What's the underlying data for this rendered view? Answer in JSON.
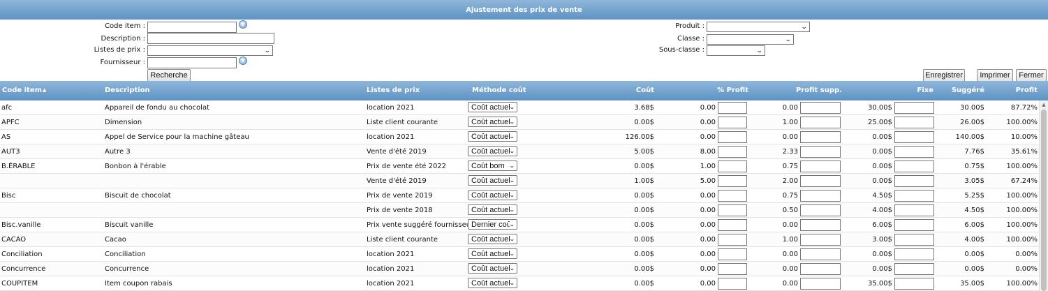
{
  "window": {
    "title": "Ajustement des prix de vente"
  },
  "filters": {
    "code_item_label": "Code item :",
    "description_label": "Description :",
    "listes_prix_label": "Listes de prix :",
    "fournisseur_label": "Fournisseur :",
    "produit_label": "Produit :",
    "classe_label": "Classe :",
    "sous_classe_label": "Sous-classe :",
    "code_item_value": "",
    "description_value": "",
    "fournisseur_value": "",
    "listes_prix_value": "",
    "produit_value": "",
    "classe_value": "",
    "sous_classe_value": ""
  },
  "buttons": {
    "recherche": "Recherche",
    "enregistrer": "Enregistrer",
    "imprimer": "Imprimer",
    "fermer": "Fermer"
  },
  "table": {
    "headers": {
      "code": "Code item",
      "description": "Description",
      "liste": "Listes de prix",
      "methode": "Méthode coût",
      "cout": "Coût",
      "profit_pct": "% Profit",
      "profit_supp": "Profit supp.",
      "fixe": "Fixe",
      "suggere": "Suggéré",
      "profit": "Profit"
    },
    "sort_column": "code",
    "sort_direction": "ascending",
    "rows": [
      {
        "code": "afc",
        "description": "Appareil de fondu au chocolat",
        "liste": "location 2021",
        "methode": "Coût actuel",
        "cout": "3.68$",
        "profit_pct": "0.00",
        "profit_supp": "0.00",
        "fixe": "30.00$",
        "suggere": "30.00$",
        "profit": "87.72%"
      },
      {
        "code": "APFC",
        "description": "Dimension",
        "liste": "Liste client courante",
        "methode": "Coût actuel",
        "cout": "0.00$",
        "profit_pct": "0.00",
        "profit_supp": "1.00",
        "fixe": "25.00$",
        "suggere": "26.00$",
        "profit": "100.00%"
      },
      {
        "code": "AS",
        "description": "Appel de Service pour la machine gâteau",
        "liste": "location 2021",
        "methode": "Coût actuel",
        "cout": "126.00$",
        "profit_pct": "0.00",
        "profit_supp": "0.00",
        "fixe": "0.00$",
        "suggere": "140.00$",
        "profit": "10.00%"
      },
      {
        "code": "AUT3",
        "description": "Autre 3",
        "liste": "Vente d'été 2019",
        "methode": "Coût actuel",
        "cout": "5.00$",
        "profit_pct": "8.00",
        "profit_supp": "2.33",
        "fixe": "0.00$",
        "suggere": "7.76$",
        "profit": "35.61%"
      },
      {
        "code": "B.ÉRABLE",
        "description": "Bonbon à l'érable",
        "liste": "Prix de vente été 2022",
        "methode": "Coût bom",
        "cout": "0.00$",
        "profit_pct": "1.00",
        "profit_supp": "0.75",
        "fixe": "0.00$",
        "suggere": "0.75$",
        "profit": "100.00%"
      },
      {
        "code": "",
        "description": "",
        "liste": "Vente d'été 2019",
        "methode": "Coût actuel",
        "cout": "1.00$",
        "profit_pct": "5.00",
        "profit_supp": "2.00",
        "fixe": "0.00$",
        "suggere": "3.05$",
        "profit": "67.24%"
      },
      {
        "code": "Bisc",
        "description": "Biscuit de chocolat",
        "liste": "Prix de vente 2019",
        "methode": "Coût actuel",
        "cout": "0.00$",
        "profit_pct": "0.00",
        "profit_supp": "0.75",
        "fixe": "4.50$",
        "suggere": "5.25$",
        "profit": "100.00%"
      },
      {
        "code": "",
        "description": "",
        "liste": "Prix de vente 2018",
        "methode": "Coût actuel",
        "cout": "0.00$",
        "profit_pct": "0.00",
        "profit_supp": "0.50",
        "fixe": "4.00$",
        "suggere": "4.50$",
        "profit": "100.00%"
      },
      {
        "code": "Bisc.vanille",
        "description": "Biscuit vanille",
        "liste": "Prix vente suggéré fournisseur",
        "methode": "Dernier coût",
        "cout": "0.00$",
        "profit_pct": "0.00",
        "profit_supp": "0.00",
        "fixe": "6.00$",
        "suggere": "6.00$",
        "profit": "100.00%"
      },
      {
        "code": "CACAO",
        "description": "Cacao",
        "liste": "Liste client courante",
        "methode": "Coût actuel",
        "cout": "0.00$",
        "profit_pct": "0.00",
        "profit_supp": "1.00",
        "fixe": "3.00$",
        "suggere": "4.00$",
        "profit": "100.00%"
      },
      {
        "code": "Conciliation",
        "description": "Conciliation",
        "liste": "location 2021",
        "methode": "Coût actuel",
        "cout": "0.00$",
        "profit_pct": "0.00",
        "profit_supp": "0.00",
        "fixe": "0.00$",
        "suggere": "0.00$",
        "profit": "0.00%"
      },
      {
        "code": "Concurrence",
        "description": "Concurrence",
        "liste": "location 2021",
        "methode": "Coût actuel",
        "cout": "0.00$",
        "profit_pct": "0.00",
        "profit_supp": "0.00",
        "fixe": "0.00$",
        "suggere": "0.00$",
        "profit": "0.00%"
      },
      {
        "code": "COUPITEM",
        "description": "Item coupon rabais",
        "liste": "location 2021",
        "methode": "Coût actuel",
        "cout": "0.00$",
        "profit_pct": "0.00",
        "profit_supp": "0.00",
        "fixe": "35.00$",
        "suggere": "35.00$",
        "profit": "100.00%"
      }
    ]
  },
  "icons": {
    "lookup": "chevron-circle-icon",
    "dropdown": "chevron-down-icon",
    "sort": "sort-up-icon"
  }
}
